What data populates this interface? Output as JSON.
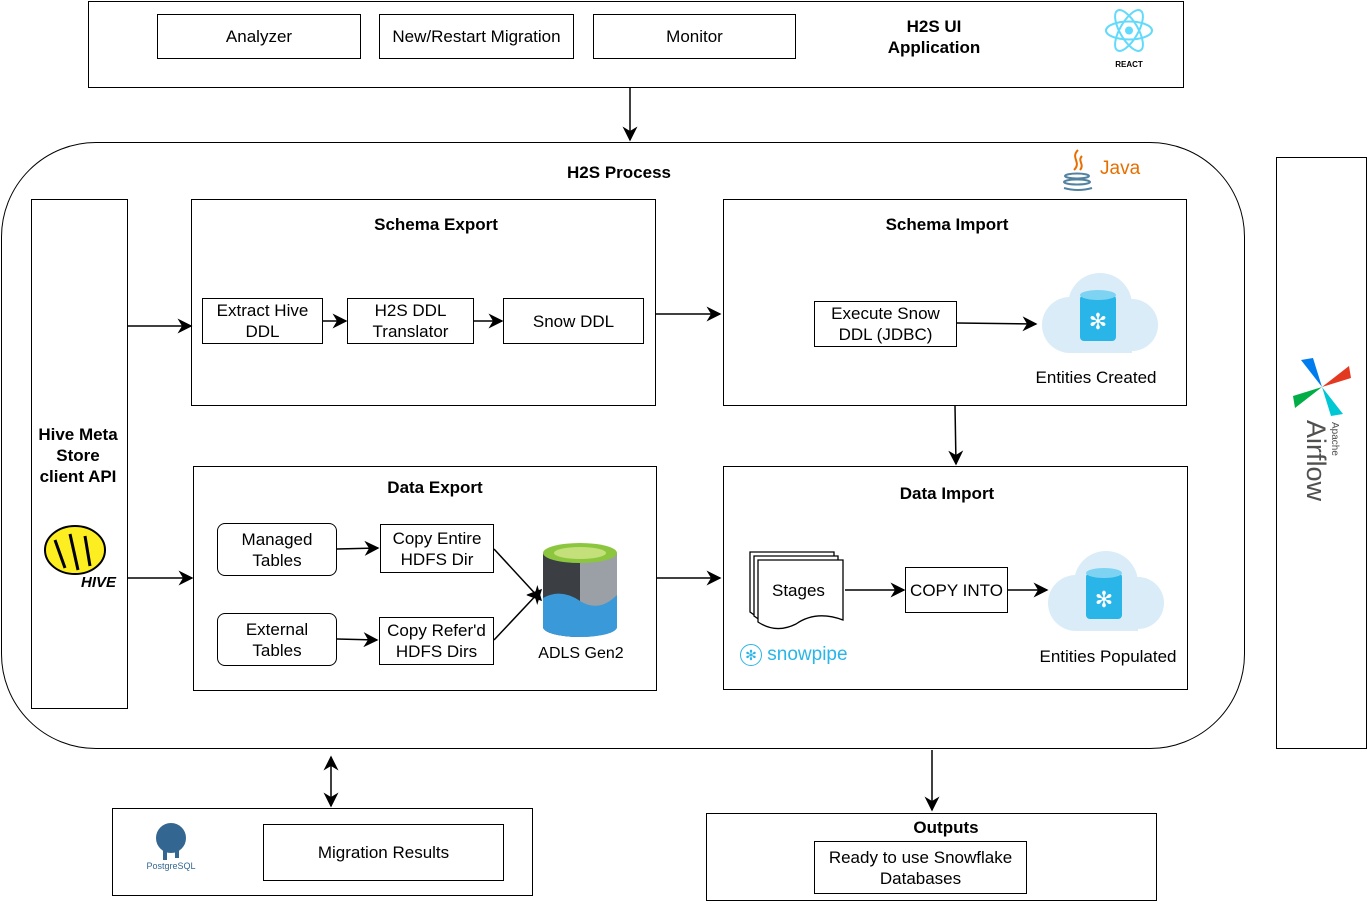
{
  "ui_app": {
    "title": "H2S UI\nApplication",
    "buttons": [
      "Analyzer",
      "New/Restart Migration",
      "Monitor"
    ],
    "logo_text": "REACT"
  },
  "process": {
    "title": "H2S Process",
    "logo_text": "Java"
  },
  "hive": {
    "label": "Hive Meta Store client API",
    "logo_text": "HIVE"
  },
  "schema_export": {
    "title": "Schema Export",
    "steps": [
      "Extract Hive DDL",
      "H2S DDL Translator",
      "Snow DDL"
    ]
  },
  "schema_import": {
    "title": "Schema Import",
    "step": "Execute Snow DDL (JDBC)",
    "result": "Entities Created"
  },
  "data_export": {
    "title": "Data Export",
    "managed": "Managed Tables",
    "external": "External Tables",
    "copy_entire": "Copy Entire HDFS Dir",
    "copy_referd": "Copy Refer'd HDFS Dirs",
    "storage": "ADLS Gen2"
  },
  "data_import": {
    "title": "Data Import",
    "stages": "Stages",
    "copy": "COPY INTO",
    "result": "Entities Populated",
    "snowpipe": "snowpipe"
  },
  "airflow": {
    "apache": "Apache",
    "name": "Airflow"
  },
  "postgres": {
    "logo_text": "PostgreSQL",
    "results": "Migration Results"
  },
  "outputs": {
    "title": "Outputs",
    "item": "Ready to use Snowflake Databases"
  },
  "colors": {
    "snowflake": "#29B5E8",
    "react": "#61DAFB",
    "java": "#E76F00"
  }
}
